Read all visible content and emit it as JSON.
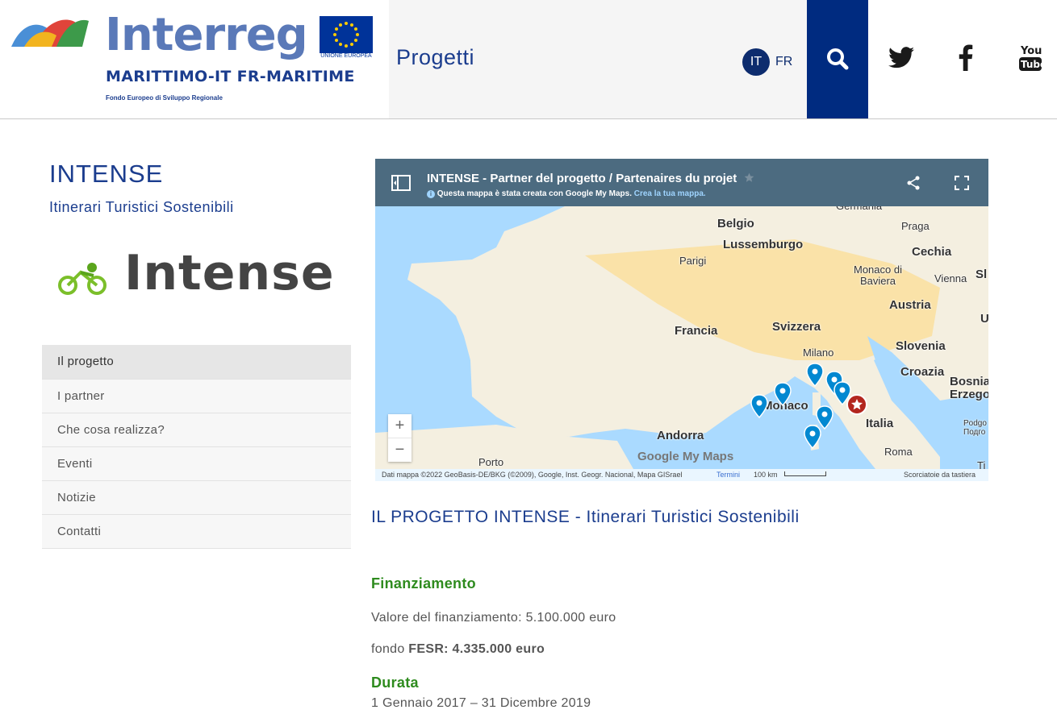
{
  "header": {
    "brand": "Interreg",
    "eu_label": "UNIONE EUROPEA",
    "programme": "MARITTIMO-IT FR-MARITIME",
    "fund": "Fondo Europeo di Sviluppo Regionale",
    "section_title": "Progetti",
    "languages": {
      "it": "IT",
      "fr": "FR"
    },
    "icons": [
      "search-icon",
      "twitter-icon",
      "facebook-icon",
      "youtube-icon"
    ]
  },
  "sidebar": {
    "project_title": "INTENSE",
    "project_subtitle": "Itinerari Turistici Sostenibili",
    "logo_text": "Intense",
    "nav": [
      {
        "label": "Il progetto",
        "active": true
      },
      {
        "label": "I partner",
        "active": false
      },
      {
        "label": "Che cosa realizza?",
        "active": false
      },
      {
        "label": "Eventi",
        "active": false
      },
      {
        "label": "Notizie",
        "active": false
      },
      {
        "label": "Contatti",
        "active": false
      }
    ]
  },
  "map": {
    "title": "INTENSE - Partner del progetto / Partenaires du projet",
    "subtitle": "Questa mappa è stata creata con Google My Maps.",
    "subtitle_link": "Crea la tua mappa.",
    "labels": {
      "germania": "Germania",
      "praga": "Praga",
      "belgio": "Belgio",
      "lussemburgo": "Lussemburgo",
      "cechia": "Cechia",
      "parigi": "Parigi",
      "monaco_baviera": "Monaco di Baviera",
      "vienna": "Vienna",
      "sl": "Sl",
      "austria": "Austria",
      "francia": "Francia",
      "svizzera": "Svizzera",
      "u": "U",
      "slovenia": "Slovenia",
      "milano": "Milano",
      "croazia": "Croazia",
      "bosnia": "Bosnia",
      "erzegov": "Erzegov",
      "monaco": "Monaco",
      "italia": "Italia",
      "podgorica": "Podgo",
      "podgorica_cyr": "Подго",
      "andorra": "Andorra",
      "roma": "Roma",
      "porto": "Porto",
      "ti": "Ti"
    },
    "google_mark": "Google My Maps",
    "attribution": "Dati mappa ©2022 GeoBasis-DE/BKG (©2009), Google, Inst. Geogr. Nacional, Mapa GISrael",
    "terms": "Termini",
    "scale": "100 km",
    "shortcuts": "Scorciatoie da tastiera",
    "zoom_in": "+",
    "zoom_out": "−"
  },
  "content": {
    "heading": "IL PROGETTO INTENSE - Itinerari Turistici Sostenibili",
    "funding_title": "Finanziamento",
    "funding_value": "Valore del finanziamento: 5.100.000 euro",
    "fesr_label": "fondo",
    "fesr_value": "FESR: 4.335.000 euro",
    "duration_title": "Durata",
    "duration_value": "1 Gennaio 2017 – 31 Dicembre 2019"
  },
  "colors": {
    "brand_blue": "#1b3d8e",
    "search_bg": "#002b80",
    "green": "#2e8b1e",
    "map_header": "#4c6b80"
  }
}
